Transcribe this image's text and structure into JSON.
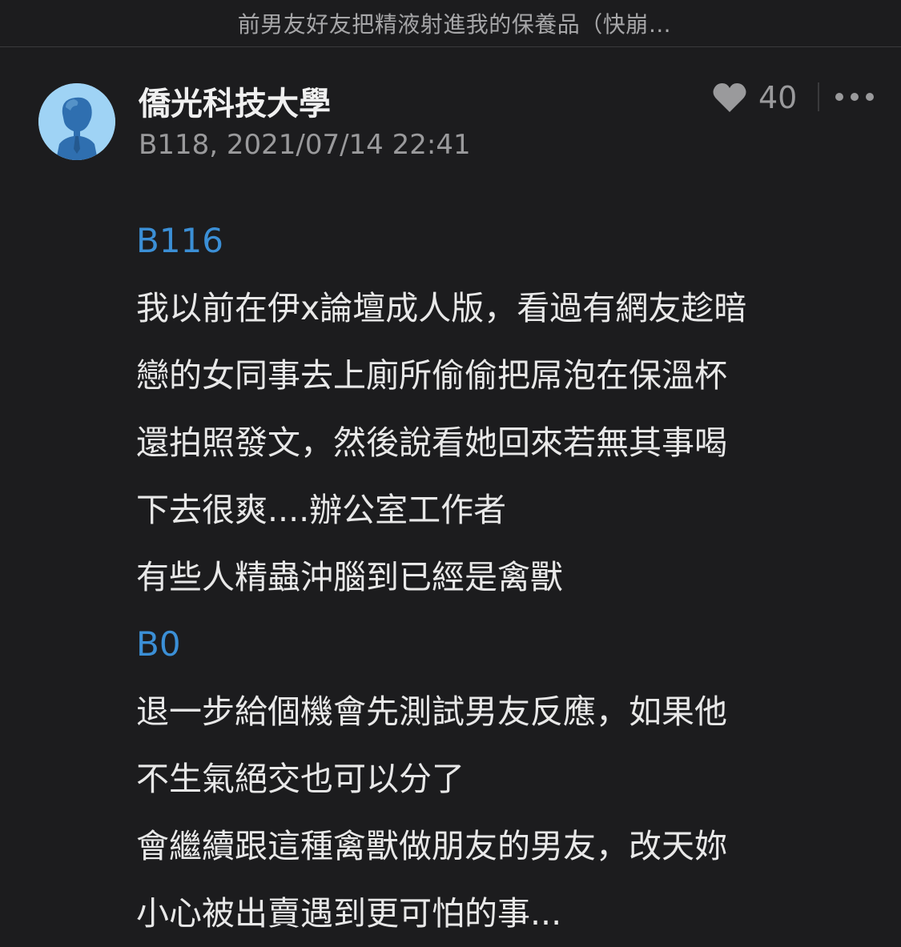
{
  "header": {
    "title": "前男友好友把精液射進我的保養品（快崩…"
  },
  "comment": {
    "author": "僑光科技大學",
    "meta": "B118, 2021/07/14 22:41",
    "likes": "40",
    "lines": [
      {
        "type": "ref",
        "text": "B116"
      },
      {
        "type": "text",
        "text": "我以前在伊x論壇成人版，看過有網友趁暗"
      },
      {
        "type": "text",
        "text": "戀的女同事去上廁所偷偷把屌泡在保溫杯"
      },
      {
        "type": "text",
        "text": "還拍照發文，然後說看她回來若無其事喝"
      },
      {
        "type": "text",
        "text": "下去很爽....辦公室工作者"
      },
      {
        "type": "text",
        "text": "有些人精蟲沖腦到已經是禽獸"
      },
      {
        "type": "ref",
        "text": "B0"
      },
      {
        "type": "text",
        "text": "退一步給個機會先測試男友反應，如果他"
      },
      {
        "type": "text",
        "text": "不生氣絕交也可以分了"
      },
      {
        "type": "text",
        "text": "會繼續跟這種禽獸做朋友的男友，改天妳"
      },
      {
        "type": "text",
        "text": "小心被出賣遇到更可怕的事..."
      }
    ]
  },
  "colors": {
    "background": "#1c1c1e",
    "link": "#3b8fd6",
    "avatar": "#9fd3f5"
  }
}
